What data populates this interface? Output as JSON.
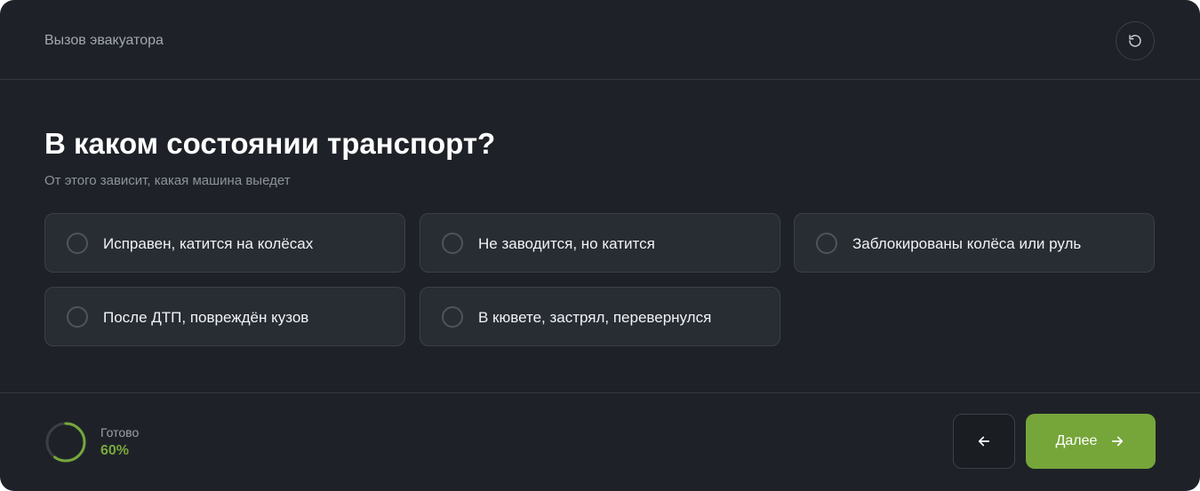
{
  "header": {
    "title": "Вызов эвакуатора",
    "reset_icon": "refresh-icon"
  },
  "question": {
    "title": "В каком состоянии транспорт?",
    "subtitle": "От этого зависит, какая машина выедет"
  },
  "options": [
    {
      "label": "Исправен, катится на колёсах",
      "selected": false
    },
    {
      "label": "Не заводится, но катится",
      "selected": false
    },
    {
      "label": "Заблокированы колёса или руль",
      "selected": false
    },
    {
      "label": "После ДТП, повреждён кузов",
      "selected": false
    },
    {
      "label": "В кювете, застрял, перевернулся",
      "selected": false
    }
  ],
  "footer": {
    "ready_label": "Готово",
    "ready_value": "60%",
    "progress_fraction": 0.6,
    "back_icon": "arrow-left-icon",
    "next_label": "Далее",
    "next_icon": "arrow-right-icon"
  },
  "colors": {
    "background": "#1e2228",
    "accent": "#76a63a",
    "progress_text": "#7aa83c",
    "option_bg": "#282d34",
    "border": "#3b4048"
  }
}
